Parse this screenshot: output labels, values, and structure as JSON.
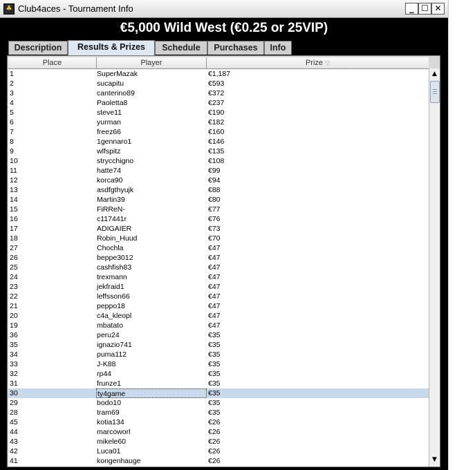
{
  "window": {
    "title": "Club4aces - Tournament Info",
    "icon": "club-icon",
    "controls": {
      "minimize": "_",
      "maximize": "☐",
      "close": "✕"
    }
  },
  "header": {
    "title": "€5,000 Wild West (€0.25 or 25VIP)"
  },
  "tabs": [
    {
      "label": "Description",
      "active": false
    },
    {
      "label": "Results & Prizes",
      "active": true
    },
    {
      "label": "Schedule",
      "active": false
    },
    {
      "label": "Purchases",
      "active": false
    },
    {
      "label": "Info",
      "active": false
    }
  ],
  "table": {
    "columns": [
      "Place",
      "Player",
      "Prize"
    ],
    "sort_indicator": "▽",
    "selected_row_index": 33,
    "rows": [
      [
        "1",
        "SuperMazak",
        "€1,187"
      ],
      [
        "2",
        "sucapitu",
        "€593"
      ],
      [
        "3",
        "canterino89",
        "€372"
      ],
      [
        "4",
        "Paoletta8",
        "€237"
      ],
      [
        "5",
        "steve11",
        "€190"
      ],
      [
        "6",
        "yurman",
        "€182"
      ],
      [
        "7",
        "freez66",
        "€160"
      ],
      [
        "8",
        "1gennaro1",
        "€146"
      ],
      [
        "9",
        "wlfspitz",
        "€135"
      ],
      [
        "10",
        "strycchigno",
        "€108"
      ],
      [
        "11",
        "hatte74",
        "€99"
      ],
      [
        "12",
        "korca90",
        "€94"
      ],
      [
        "13",
        "asdfgthyujk",
        "€88"
      ],
      [
        "14",
        "Martin39",
        "€80"
      ],
      [
        "15",
        "FiRReN-",
        "€77"
      ],
      [
        "16",
        "c117441r",
        "€76"
      ],
      [
        "17",
        "ADIGAIER",
        "€73"
      ],
      [
        "18",
        "Robin_Huud",
        "€70"
      ],
      [
        "27",
        "Chochla",
        "€47"
      ],
      [
        "26",
        "beppe3012",
        "€47"
      ],
      [
        "25",
        "cashfish83",
        "€47"
      ],
      [
        "24",
        "trexmann",
        "€47"
      ],
      [
        "23",
        "jekfraid1",
        "€47"
      ],
      [
        "22",
        "leffsson66",
        "€47"
      ],
      [
        "21",
        "peppo18",
        "€47"
      ],
      [
        "20",
        "c4a_kleopl",
        "€47"
      ],
      [
        "19",
        "mbatato",
        "€47"
      ],
      [
        "36",
        "peru24",
        "€35"
      ],
      [
        "35",
        "ignazio741",
        "€35"
      ],
      [
        "34",
        "puma112",
        "€35"
      ],
      [
        "33",
        "J-K88",
        "€35"
      ],
      [
        "32",
        "rp44",
        "€35"
      ],
      [
        "31",
        "frunze1",
        "€35"
      ],
      [
        "30",
        "ty4game",
        "€35"
      ],
      [
        "29",
        "bodo10",
        "€35"
      ],
      [
        "28",
        "tram69",
        "€35"
      ],
      [
        "45",
        "kotia134",
        "€26"
      ],
      [
        "44",
        "marcoworl",
        "€26"
      ],
      [
        "43",
        "mikele60",
        "€26"
      ],
      [
        "42",
        "Luca01",
        "€26"
      ],
      [
        "41",
        "kongenhauge",
        "€26"
      ]
    ]
  },
  "scrollbar": {
    "up": "▲",
    "down": "▼"
  }
}
